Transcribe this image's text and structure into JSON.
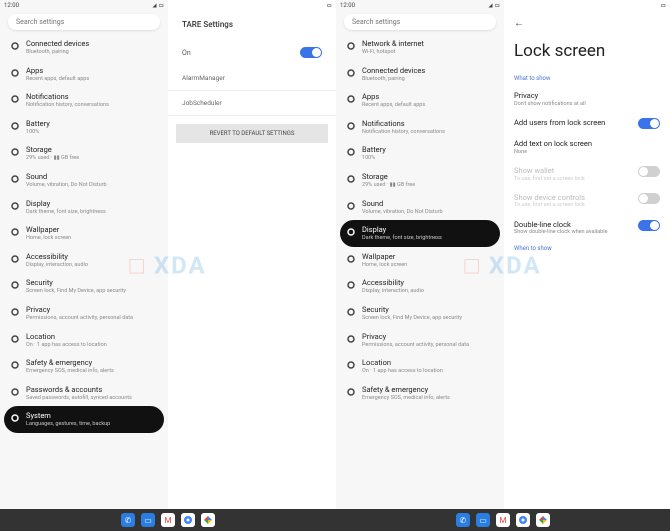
{
  "status": {
    "time": "12:00"
  },
  "search_placeholder": "Search settings",
  "panel1": {
    "items": [
      {
        "t": "Connected devices",
        "s": "Bluetooth, pairing"
      },
      {
        "t": "Apps",
        "s": "Recent apps, default apps"
      },
      {
        "t": "Notifications",
        "s": "Notification history, conversations"
      },
      {
        "t": "Battery",
        "s": "100%"
      },
      {
        "t": "Storage",
        "s": "29% used · ▮▮ GB free"
      },
      {
        "t": "Sound",
        "s": "Volume, vibration, Do Not Disturb"
      },
      {
        "t": "Display",
        "s": "Dark theme, font size, brightness"
      },
      {
        "t": "Wallpaper",
        "s": "Home, lock screen"
      },
      {
        "t": "Accessibility",
        "s": "Display, interaction, audio"
      },
      {
        "t": "Security",
        "s": "Screen lock, Find My Device, app security"
      },
      {
        "t": "Privacy",
        "s": "Permissions, account activity, personal data"
      },
      {
        "t": "Location",
        "s": "On · 1 app has access to location"
      },
      {
        "t": "Safety & emergency",
        "s": "Emergency SOS, medical info, alerts"
      },
      {
        "t": "Passwords & accounts",
        "s": "Saved passwords, autofill, synced accounts"
      },
      {
        "t": "System",
        "s": "Languages, gestures, time, backup"
      }
    ]
  },
  "panel2": {
    "title": "TARE Settings",
    "on": "On",
    "links": [
      "AlarmManager",
      "JobScheduler"
    ],
    "revert": "REVERT TO DEFAULT SETTINGS"
  },
  "panel3": {
    "items": [
      {
        "t": "Network & internet",
        "s": "Wi-Fi, hotspot"
      },
      {
        "t": "Connected devices",
        "s": "Bluetooth, pairing"
      },
      {
        "t": "Apps",
        "s": "Recent apps, default apps"
      },
      {
        "t": "Notifications",
        "s": "Notification history, conversations"
      },
      {
        "t": "Battery",
        "s": "100%"
      },
      {
        "t": "Storage",
        "s": "29% used · ▮▮ GB free"
      },
      {
        "t": "Sound",
        "s": "Volume, vibration, Do Not Disturb"
      },
      {
        "t": "Display",
        "s": "Dark theme, font size, brightness"
      },
      {
        "t": "Wallpaper",
        "s": "Home, lock screen"
      },
      {
        "t": "Accessibility",
        "s": "Display, interaction, audio"
      },
      {
        "t": "Security",
        "s": "Screen lock, Find My Device, app security"
      },
      {
        "t": "Privacy",
        "s": "Permissions, account activity, personal data"
      },
      {
        "t": "Location",
        "s": "On · 1 app has access to location"
      },
      {
        "t": "Safety & emergency",
        "s": "Emergency SOS, medical info, alerts"
      }
    ]
  },
  "panel4": {
    "title": "Lock screen",
    "sec1": "What to show",
    "sec2": "When to show",
    "opts": [
      {
        "t": "Privacy",
        "s": "Don't show notifications at all",
        "sw": ""
      },
      {
        "t": "Add users from lock screen",
        "s": "",
        "sw": "on"
      },
      {
        "t": "Add text on lock screen",
        "s": "None",
        "sw": ""
      },
      {
        "t": "Show wallet",
        "s": "To use, first set a screen lock",
        "sw": "off",
        "dis": true
      },
      {
        "t": "Show device controls",
        "s": "To use, first set a screen lock",
        "sw": "off",
        "dis": true
      },
      {
        "t": "Double-line clock",
        "s": "Show double-line clock when available",
        "sw": "on"
      }
    ]
  },
  "watermark": "□ XDA",
  "tb": [
    "phone",
    "msg",
    "gmail",
    "chrome",
    "photos"
  ]
}
